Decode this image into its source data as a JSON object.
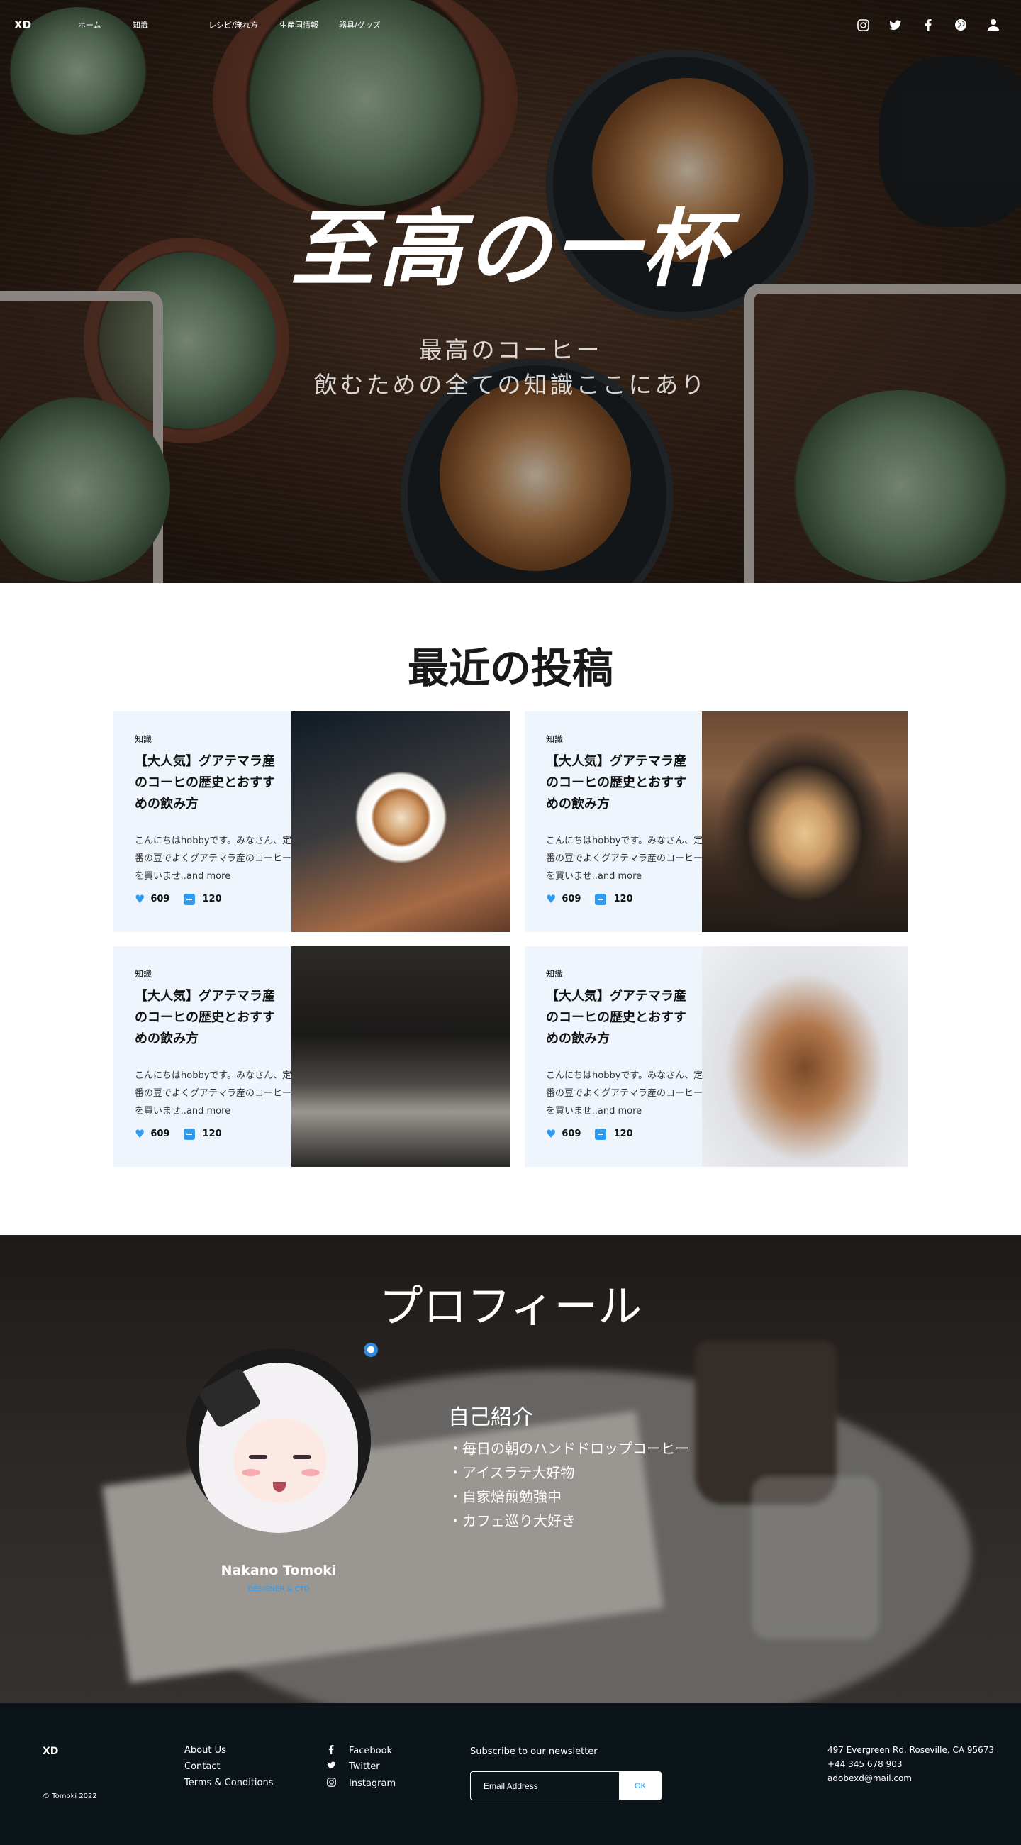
{
  "nav": {
    "logo": "XD",
    "links": [
      "ホーム",
      "知識",
      "レシピ/淹れ方",
      "生産国情報",
      "器具/グッズ"
    ],
    "icons": [
      "instagram-icon",
      "twitter-icon",
      "facebook-icon",
      "globe-icon",
      "user-icon"
    ]
  },
  "hero": {
    "title": "至高の一杯",
    "subtitle_line1": "最高のコーヒー",
    "subtitle_line2": "飲むための全ての知識ここにあり"
  },
  "recent": {
    "title": "最近の投稿",
    "posts": [
      {
        "category": "知識",
        "title": "【大人気】グアテマラ産のコーヒの歴史とおすすめの飲み方",
        "excerpt": "こんにちはhobbyです。みなさん、定番の豆でよくグアテマラ産のコーヒーを買いませ..and more",
        "likes": "609",
        "comments": "120"
      },
      {
        "category": "知識",
        "title": "【大人気】グアテマラ産のコーヒの歴史とおすすめの飲み方",
        "excerpt": "こんにちはhobbyです。みなさん、定番の豆でよくグアテマラ産のコーヒーを買いませ..and more",
        "likes": "609",
        "comments": "120"
      },
      {
        "category": "知識",
        "title": "【大人気】グアテマラ産のコーヒの歴史とおすすめの飲み方",
        "excerpt": "こんにちはhobbyです。みなさん、定番の豆でよくグアテマラ産のコーヒーを買いませ..and more",
        "likes": "609",
        "comments": "120"
      },
      {
        "category": "知識",
        "title": "【大人気】グアテマラ産のコーヒの歴史とおすすめの飲み方",
        "excerpt": "こんにちはhobbyです。みなさん、定番の豆でよくグアテマラ産のコーヒーを買いませ..and more",
        "likes": "609",
        "comments": "120"
      }
    ]
  },
  "profile": {
    "title": "プロフィール",
    "name": "Nakano Tomoki",
    "role": "DESIGNER & CTO",
    "intro_heading": "自己紹介",
    "intro_items": [
      "・毎日の朝のハンドドロップコーヒー",
      "・アイスラテ大好物",
      "・自家焙煎勉強中",
      "・カフェ巡り大好き"
    ]
  },
  "footer": {
    "logo": "XD",
    "copyright": "© Tomoki 2022",
    "links": [
      "About Us",
      "Contact",
      "Terms & Conditions"
    ],
    "social": [
      "Facebook",
      "Twitter",
      "Instagram"
    ],
    "newsletter_label": "Subscribe to our newsletter",
    "email_placeholder": "Email Address",
    "ok_label": "OK",
    "address": [
      "497 Evergreen Rd. Roseville, CA 95673",
      "+44 345 678 903",
      "adobexd@mail.com"
    ]
  },
  "colors": {
    "accent": "#2f9bf0",
    "card_bg": "#eef5fc",
    "footer_bg": "#0b1418"
  }
}
